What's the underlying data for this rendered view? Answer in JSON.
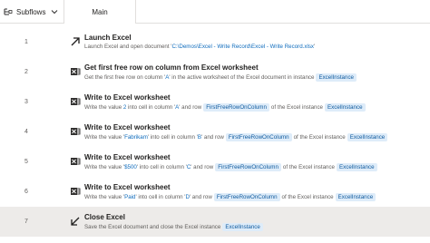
{
  "tabbar": {
    "subflows_label": "Subflows",
    "main_tab_label": "Main"
  },
  "steps": [
    {
      "number": "1",
      "title": "Launch Excel",
      "icon": "launch-arrow-icon",
      "desc": {
        "prefix": "Launch Excel and open document '",
        "value": "C:\\Demos\\Excel - Write Record\\Excel - Write Record.xlsx",
        "suffix": "'"
      }
    },
    {
      "number": "2",
      "title": "Get first free row on column from Excel worksheet",
      "icon": "excel-icon",
      "desc": {
        "t1": "Get the first free row on column '",
        "v1": "A",
        "t2": "' in the active worksheet of the Excel document in instance",
        "var1": "ExcelInstance"
      }
    },
    {
      "number": "3",
      "title": "Write to Excel worksheet",
      "icon": "excel-icon",
      "desc": {
        "t1": "Write the value ",
        "v1": "2",
        "t2": " into cell in column '",
        "v2": "A",
        "t3": "' and row",
        "var1": "FirstFreeRowOnColumn",
        "t4": "of the Excel instance",
        "var2": "ExcelInstance"
      }
    },
    {
      "number": "4",
      "title": "Write to Excel worksheet",
      "icon": "excel-icon",
      "desc": {
        "t1": "Write the value '",
        "v1": "Fabrikam",
        "t2": "' into cell in column '",
        "v2": "B",
        "t3": "' and row",
        "var1": "FirstFreeRowOnColumn",
        "t4": "of the Excel instance",
        "var2": "ExcelInstance"
      }
    },
    {
      "number": "5",
      "title": "Write to Excel worksheet",
      "icon": "excel-icon",
      "desc": {
        "t1": "Write the value '",
        "v1": "$500",
        "t2": "' into cell in column '",
        "v2": "C",
        "t3": "' and row",
        "var1": "FirstFreeRowOnColumn",
        "t4": "of the Excel instance",
        "var2": "ExcelInstance"
      }
    },
    {
      "number": "6",
      "title": "Write to Excel worksheet",
      "icon": "excel-icon",
      "desc": {
        "t1": "Write the value '",
        "v1": "Paid",
        "t2": "' into cell in column '",
        "v2": "D",
        "t3": "' and row",
        "var1": "FirstFreeRowOnColumn",
        "t4": "of the Excel instance",
        "var2": "ExcelInstance"
      }
    },
    {
      "number": "7",
      "title": "Close Excel",
      "icon": "close-arrow-icon",
      "desc": {
        "t1": "Save the Excel document and close the Excel instance",
        "var1": "ExcelInstance"
      }
    }
  ],
  "colors": {
    "selected_row": "#edebe9",
    "variable_bg": "#deecf9",
    "variable_text": "#0f5a9e",
    "value_text": "#0f6cbd"
  }
}
